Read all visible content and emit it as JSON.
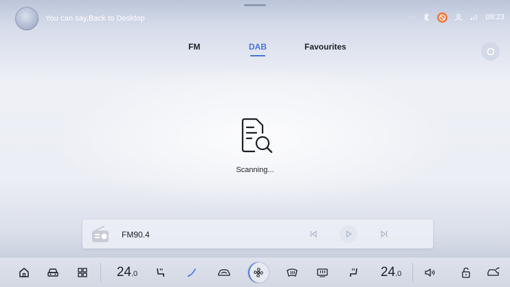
{
  "status_bar": {
    "voice_hint": "You can say,Back to Desktop",
    "more": "···",
    "clock": "09:23"
  },
  "tabs": [
    {
      "label": "FM",
      "active": false
    },
    {
      "label": "DAB",
      "active": true
    },
    {
      "label": "Favourites",
      "active": false
    }
  ],
  "scan": {
    "status_text": "Scanning..."
  },
  "player": {
    "station": "FM90.4"
  },
  "climate": {
    "left_temp": "24",
    "left_temp_decimal": ".0",
    "right_temp": "24",
    "right_temp_decimal": ".0"
  },
  "colors": {
    "accent": "#4a73d8",
    "warning": "#f07a3a",
    "text": "#1c1f26"
  },
  "dock_icons": [
    "home-icon",
    "car-icon",
    "apps-grid-icon",
    "seat-heat-left-icon",
    "wiper-icon",
    "car-ventilation-icon",
    "fan-icon",
    "front-defrost-icon",
    "rear-defrost-icon",
    "seat-heat-right-icon",
    "volume-icon",
    "unlock-icon",
    "car-settings-icon"
  ]
}
